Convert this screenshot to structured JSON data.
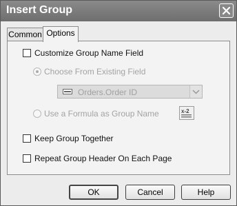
{
  "window": {
    "title": "Insert Group"
  },
  "tabs": [
    {
      "label": "Common"
    },
    {
      "label": "Options"
    }
  ],
  "options": {
    "customize_label": "Customize Group Name Field",
    "choose_existing_label": "Choose From Existing Field",
    "field_value": "Orders.Order ID",
    "formula_label": "Use a Formula as Group Name",
    "formula_button_icon": "x-2-formula-icon",
    "keep_together_label": "Keep Group Together",
    "repeat_header_label": "Repeat Group Header On Each Page"
  },
  "buttons": {
    "ok": "OK",
    "cancel": "Cancel",
    "help": "Help"
  }
}
